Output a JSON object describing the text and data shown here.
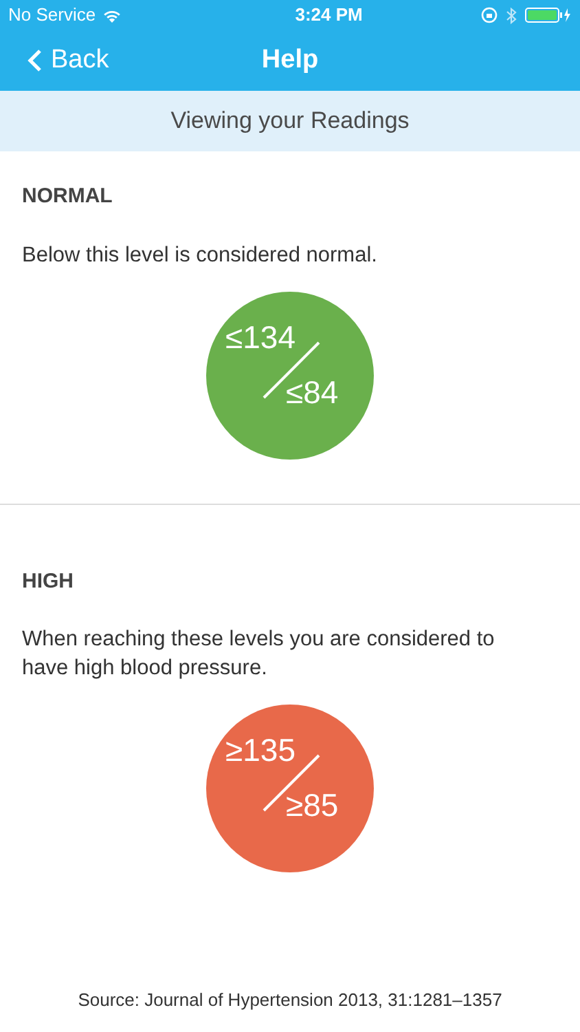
{
  "status_bar": {
    "carrier": "No Service",
    "time": "3:24 PM"
  },
  "nav": {
    "back": "Back",
    "title": "Help"
  },
  "subheader": "Viewing your Readings",
  "sections": [
    {
      "heading": "NORMAL",
      "description": "Below this level is considered normal.",
      "systolic": "≤134",
      "diastolic": "≤84",
      "color": "#6ab04c"
    },
    {
      "heading": "HIGH",
      "description": "When reaching these levels you are considered to have high blood pressure.",
      "systolic": "≥135",
      "diastolic": "≥85",
      "color": "#e8694a"
    }
  ],
  "source": "Source: Journal of Hypertension 2013, 31:1281–1357"
}
